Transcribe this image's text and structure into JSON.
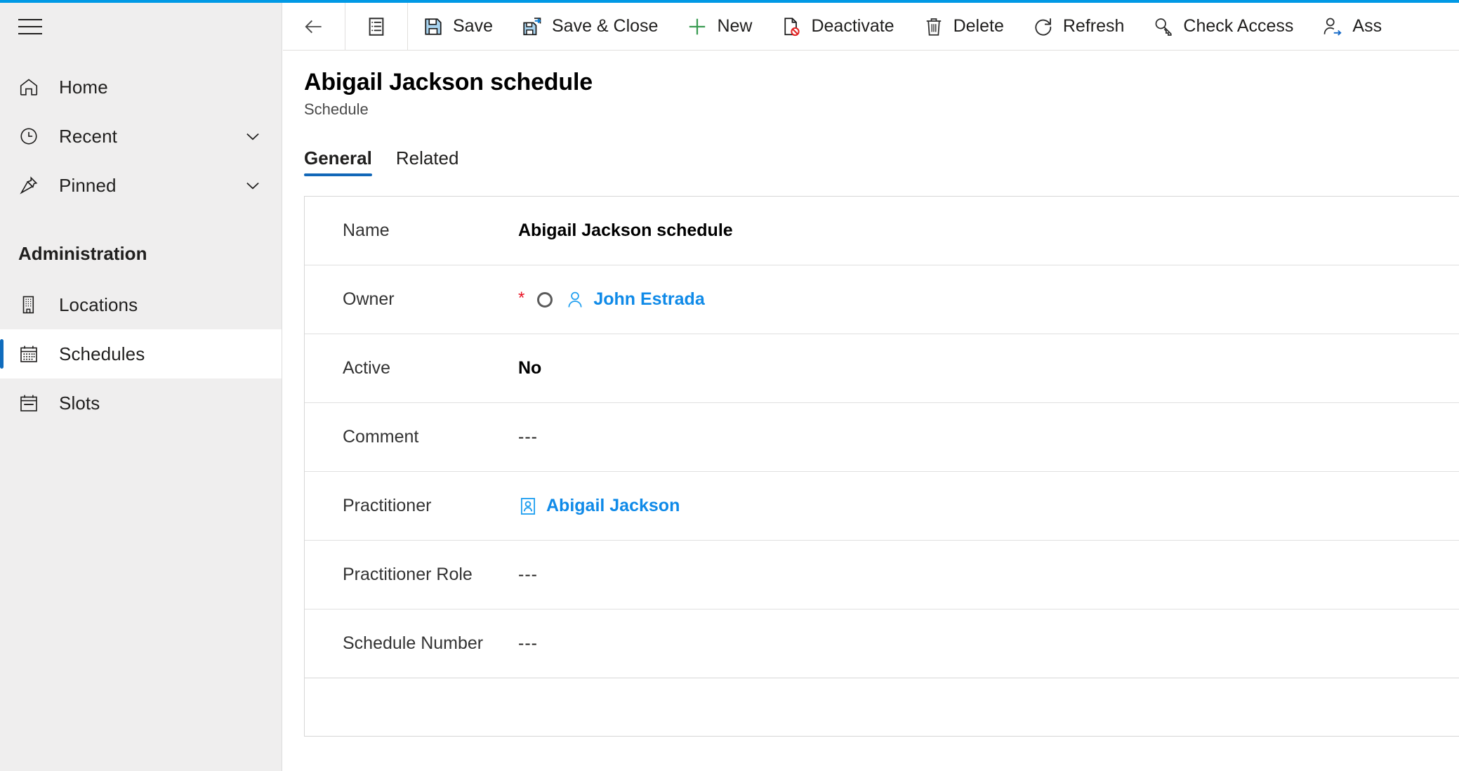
{
  "theme": {
    "accent_blue": "#0099e5",
    "selected_indicator": "#0f6cbd",
    "link_blue": "#0f8ae8",
    "required_red": "#e81123",
    "tab_underline": "#1267b8",
    "sidebar_bg": "#efeeee"
  },
  "sidebar": {
    "menu_button": "menu-icon",
    "items": [
      {
        "label": "Home",
        "icon": "home-icon",
        "expandable": false,
        "selected": false
      },
      {
        "label": "Recent",
        "icon": "clock-icon",
        "expandable": true,
        "selected": false
      },
      {
        "label": "Pinned",
        "icon": "pin-icon",
        "expandable": true,
        "selected": false
      }
    ],
    "section_header": "Administration",
    "section_items": [
      {
        "label": "Locations",
        "icon": "building-icon",
        "selected": false
      },
      {
        "label": "Schedules",
        "icon": "calendar-grid-icon",
        "selected": true
      },
      {
        "label": "Slots",
        "icon": "calendar-icon",
        "selected": false
      }
    ]
  },
  "command_bar": {
    "back": "back-arrow-icon",
    "form_selector": "form-list-icon",
    "buttons": [
      {
        "label": "Save",
        "icon": "save-icon"
      },
      {
        "label": "Save & Close",
        "icon": "save-close-icon"
      },
      {
        "label": "New",
        "icon": "plus-icon"
      },
      {
        "label": "Deactivate",
        "icon": "deactivate-icon"
      },
      {
        "label": "Delete",
        "icon": "trash-icon"
      },
      {
        "label": "Refresh",
        "icon": "refresh-icon"
      },
      {
        "label": "Check Access",
        "icon": "key-icon"
      },
      {
        "label": "Ass",
        "icon": "assign-user-icon"
      }
    ]
  },
  "page": {
    "title": "Abigail Jackson schedule",
    "subtitle": "Schedule",
    "tabs": [
      {
        "label": "General",
        "active": true
      },
      {
        "label": "Related",
        "active": false
      }
    ]
  },
  "form": {
    "rows": [
      {
        "label": "Name",
        "value": "Abigail Jackson schedule",
        "type": "text-bold"
      },
      {
        "label": "Owner",
        "value": "John Estrada",
        "type": "lookup-person",
        "required": true,
        "locked": true
      },
      {
        "label": "Active",
        "value": "No",
        "type": "text-bold"
      },
      {
        "label": "Comment",
        "value": "---",
        "type": "empty"
      },
      {
        "label": "Practitioner",
        "value": "Abigail Jackson",
        "type": "lookup-record"
      },
      {
        "label": "Practitioner Role",
        "value": "---",
        "type": "empty"
      },
      {
        "label": "Schedule Number",
        "value": "---",
        "type": "empty"
      }
    ]
  }
}
